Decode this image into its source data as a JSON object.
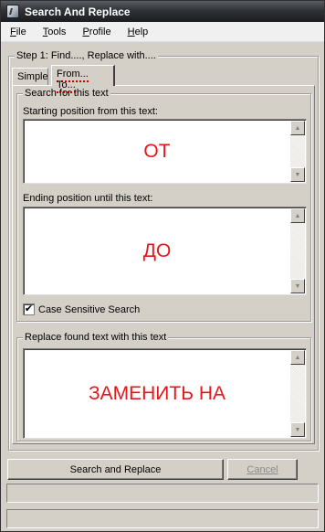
{
  "window": {
    "title": "Search And Replace"
  },
  "menu": {
    "items": [
      "File",
      "Tools",
      "Profile",
      "Help"
    ]
  },
  "step_group": {
    "legend": "Step 1: Find...., Replace with...."
  },
  "tabs": [
    {
      "label": "Simple",
      "active": false
    },
    {
      "label": "From... To...",
      "active": true
    }
  ],
  "search_group": {
    "legend": "Search for this text",
    "start_label": "Starting position from this text:",
    "start_value": "ОТ",
    "end_label": "Ending position until this text:",
    "end_value": "ДО",
    "case_sensitive_label": "Case Sensitive Search",
    "case_sensitive_checked": true,
    "check_mark": "✔"
  },
  "replace_group": {
    "legend": "Replace found text with this text",
    "value": "ЗАМЕНИТЬ НА"
  },
  "buttons": {
    "search_replace": "Search and Replace",
    "cancel": "Cancel"
  },
  "status": {
    "line1": "",
    "line2": ""
  },
  "icons": {
    "app": "app-icon",
    "scroll_up": "scroll-up-arrow-icon",
    "scroll_down": "scroll-down-arrow-icon",
    "check": "checkmark-icon"
  },
  "colors": {
    "value_text": "#e8161b",
    "window_bg": "#d4d0c8"
  }
}
